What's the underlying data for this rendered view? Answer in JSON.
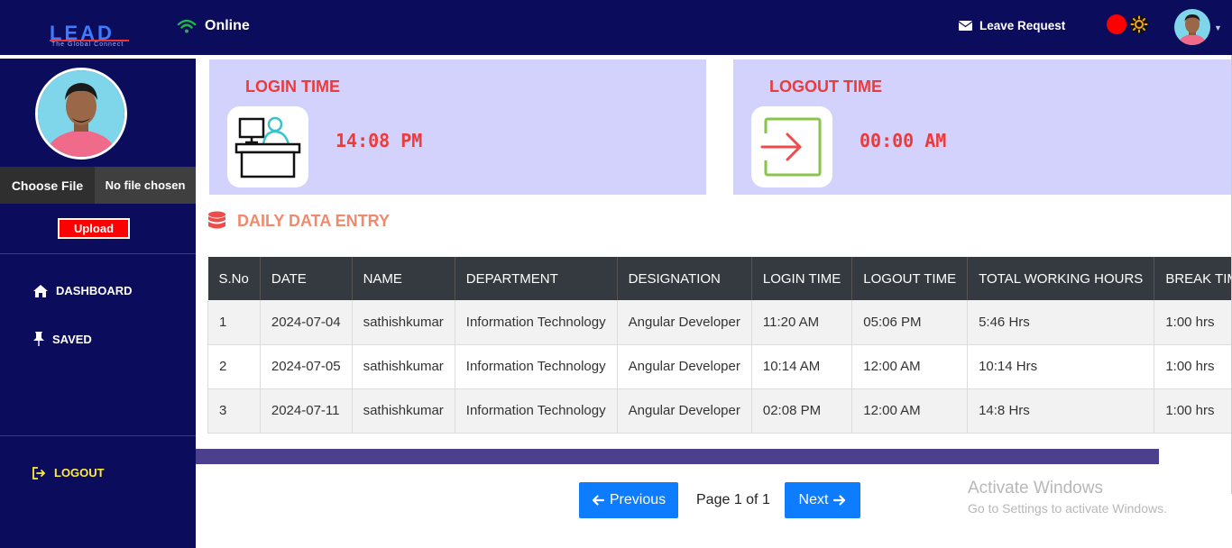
{
  "header": {
    "logo_text": "LEAD",
    "logo_tagline": "The Global Connect",
    "status": "Online",
    "leave_request": "Leave Request"
  },
  "sidebar": {
    "choose_file": "Choose File",
    "no_file": "No file chosen",
    "upload": "Upload",
    "nav": [
      {
        "label": "DASHBOARD",
        "icon": "home-icon"
      },
      {
        "label": "SAVED",
        "icon": "pin-icon"
      }
    ],
    "logout": "LOGOUT"
  },
  "login_card": {
    "title": "LOGIN TIME",
    "time": "14:08 PM"
  },
  "logout_card": {
    "title": "LOGOUT TIME",
    "time": "00:00 AM"
  },
  "section": {
    "title": "DAILY DATA ENTRY"
  },
  "table": {
    "headers": [
      "S.No",
      "DATE",
      "NAME",
      "DEPARTMENT",
      "DESIGNATION",
      "LOGIN TIME",
      "LOGOUT TIME",
      "TOTAL WORKING HOURS",
      "BREAK TIME"
    ],
    "rows": [
      [
        "1",
        "2024-07-04",
        "sathishkumar",
        "Information Technology",
        "Angular Developer",
        "11:20 AM",
        "05:06 PM",
        "5:46 Hrs",
        "1:00 hrs"
      ],
      [
        "2",
        "2024-07-05",
        "sathishkumar",
        "Information Technology",
        "Angular Developer",
        "10:14 AM",
        "12:00 AM",
        "10:14 Hrs",
        "1:00 hrs"
      ],
      [
        "3",
        "2024-07-11",
        "sathishkumar",
        "Information Technology",
        "Angular Developer",
        "02:08 PM",
        "12:00 AM",
        "14:8 Hrs",
        "1:00 hrs"
      ]
    ]
  },
  "pagination": {
    "previous": "Previous",
    "page_info": "Page 1 of 1",
    "next": "Next"
  },
  "watermark": {
    "line1": "Activate Windows",
    "line2": "Go to Settings to activate Windows."
  },
  "colors": {
    "navy": "#0c0c5c",
    "card_bg": "#d2d2fc",
    "accent_red": "#ec3b3b",
    "primary_blue": "#0d7cff"
  }
}
